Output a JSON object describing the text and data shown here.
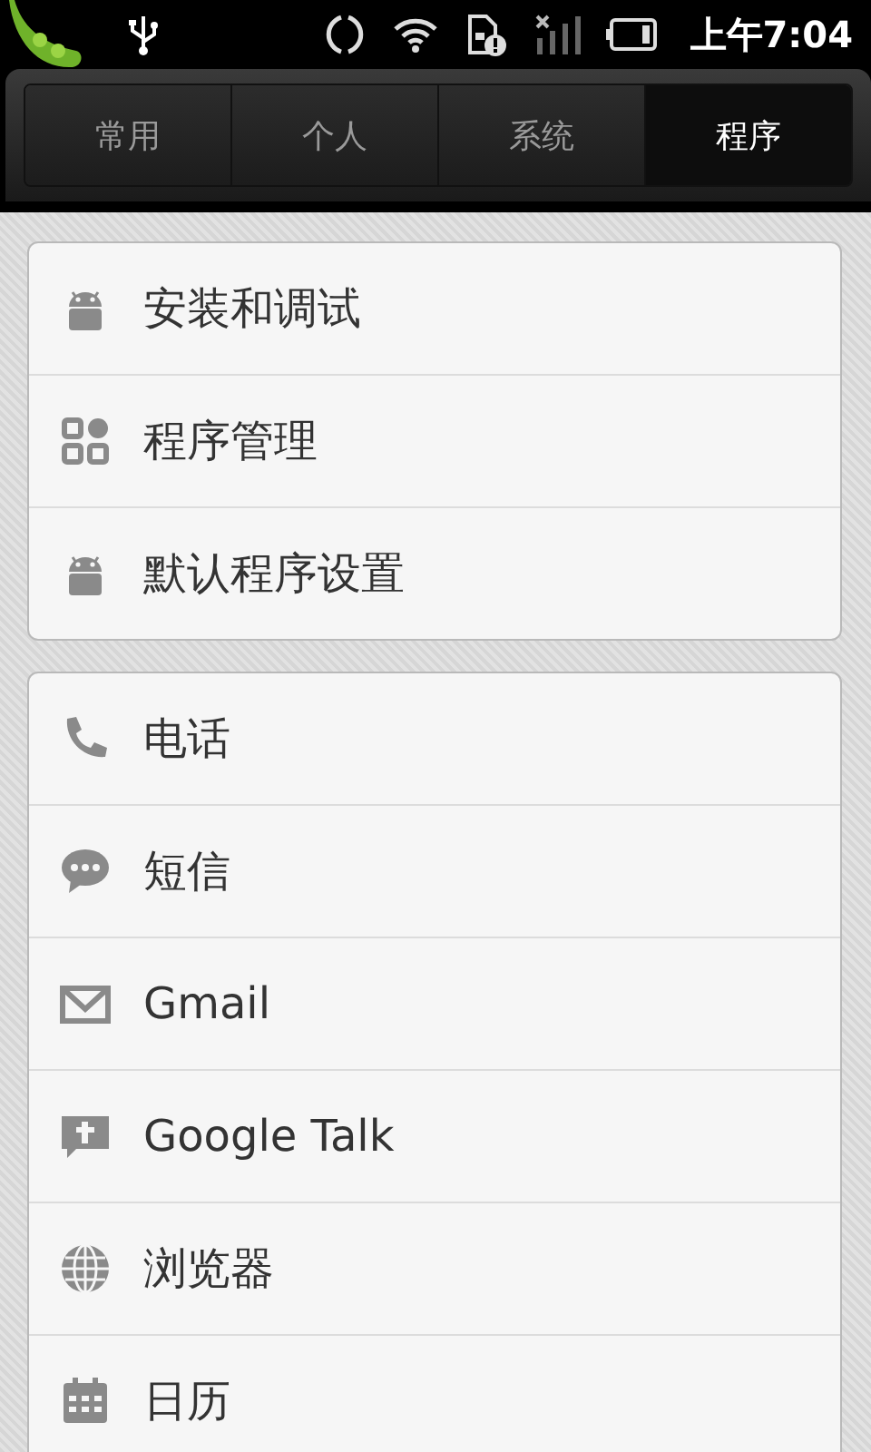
{
  "status_bar": {
    "time": "上午7:04"
  },
  "tabs": [
    {
      "label": "常用",
      "selected": false
    },
    {
      "label": "个人",
      "selected": false
    },
    {
      "label": "系统",
      "selected": false
    },
    {
      "label": "程序",
      "selected": true
    }
  ],
  "groups": [
    {
      "items": [
        {
          "label": "安装和调试",
          "kind": "android"
        },
        {
          "label": "程序管理",
          "kind": "grid"
        },
        {
          "label": "默认程序设置",
          "kind": "android"
        }
      ]
    },
    {
      "items": [
        {
          "label": "电话",
          "kind": "phone"
        },
        {
          "label": "短信",
          "kind": "chat"
        },
        {
          "label": "Gmail",
          "kind": "mail"
        },
        {
          "label": "Google Talk",
          "kind": "talk"
        },
        {
          "label": "浏览器",
          "kind": "globe"
        },
        {
          "label": "日历",
          "kind": "calendar"
        }
      ]
    }
  ]
}
